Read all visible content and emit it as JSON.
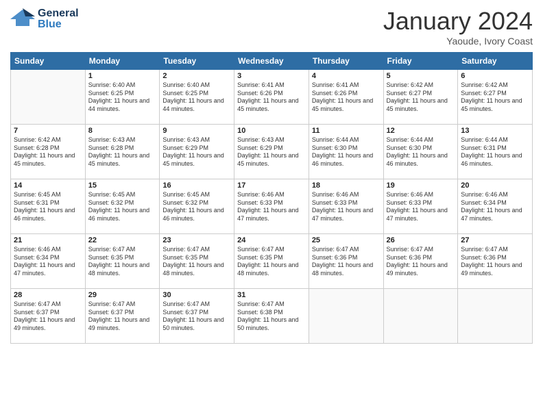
{
  "header": {
    "logo_general": "General",
    "logo_blue": "Blue",
    "month_title": "January 2024",
    "subtitle": "Yaoude, Ivory Coast"
  },
  "days_of_week": [
    "Sunday",
    "Monday",
    "Tuesday",
    "Wednesday",
    "Thursday",
    "Friday",
    "Saturday"
  ],
  "weeks": [
    [
      {
        "day": "",
        "sunrise": "",
        "sunset": "",
        "daylight": ""
      },
      {
        "day": "1",
        "sunrise": "Sunrise: 6:40 AM",
        "sunset": "Sunset: 6:25 PM",
        "daylight": "Daylight: 11 hours and 44 minutes."
      },
      {
        "day": "2",
        "sunrise": "Sunrise: 6:40 AM",
        "sunset": "Sunset: 6:25 PM",
        "daylight": "Daylight: 11 hours and 44 minutes."
      },
      {
        "day": "3",
        "sunrise": "Sunrise: 6:41 AM",
        "sunset": "Sunset: 6:26 PM",
        "daylight": "Daylight: 11 hours and 45 minutes."
      },
      {
        "day": "4",
        "sunrise": "Sunrise: 6:41 AM",
        "sunset": "Sunset: 6:26 PM",
        "daylight": "Daylight: 11 hours and 45 minutes."
      },
      {
        "day": "5",
        "sunrise": "Sunrise: 6:42 AM",
        "sunset": "Sunset: 6:27 PM",
        "daylight": "Daylight: 11 hours and 45 minutes."
      },
      {
        "day": "6",
        "sunrise": "Sunrise: 6:42 AM",
        "sunset": "Sunset: 6:27 PM",
        "daylight": "Daylight: 11 hours and 45 minutes."
      }
    ],
    [
      {
        "day": "7",
        "sunrise": "Sunrise: 6:42 AM",
        "sunset": "Sunset: 6:28 PM",
        "daylight": "Daylight: 11 hours and 45 minutes."
      },
      {
        "day": "8",
        "sunrise": "Sunrise: 6:43 AM",
        "sunset": "Sunset: 6:28 PM",
        "daylight": "Daylight: 11 hours and 45 minutes."
      },
      {
        "day": "9",
        "sunrise": "Sunrise: 6:43 AM",
        "sunset": "Sunset: 6:29 PM",
        "daylight": "Daylight: 11 hours and 45 minutes."
      },
      {
        "day": "10",
        "sunrise": "Sunrise: 6:43 AM",
        "sunset": "Sunset: 6:29 PM",
        "daylight": "Daylight: 11 hours and 45 minutes."
      },
      {
        "day": "11",
        "sunrise": "Sunrise: 6:44 AM",
        "sunset": "Sunset: 6:30 PM",
        "daylight": "Daylight: 11 hours and 46 minutes."
      },
      {
        "day": "12",
        "sunrise": "Sunrise: 6:44 AM",
        "sunset": "Sunset: 6:30 PM",
        "daylight": "Daylight: 11 hours and 46 minutes."
      },
      {
        "day": "13",
        "sunrise": "Sunrise: 6:44 AM",
        "sunset": "Sunset: 6:31 PM",
        "daylight": "Daylight: 11 hours and 46 minutes."
      }
    ],
    [
      {
        "day": "14",
        "sunrise": "Sunrise: 6:45 AM",
        "sunset": "Sunset: 6:31 PM",
        "daylight": "Daylight: 11 hours and 46 minutes."
      },
      {
        "day": "15",
        "sunrise": "Sunrise: 6:45 AM",
        "sunset": "Sunset: 6:32 PM",
        "daylight": "Daylight: 11 hours and 46 minutes."
      },
      {
        "day": "16",
        "sunrise": "Sunrise: 6:45 AM",
        "sunset": "Sunset: 6:32 PM",
        "daylight": "Daylight: 11 hours and 46 minutes."
      },
      {
        "day": "17",
        "sunrise": "Sunrise: 6:46 AM",
        "sunset": "Sunset: 6:33 PM",
        "daylight": "Daylight: 11 hours and 47 minutes."
      },
      {
        "day": "18",
        "sunrise": "Sunrise: 6:46 AM",
        "sunset": "Sunset: 6:33 PM",
        "daylight": "Daylight: 11 hours and 47 minutes."
      },
      {
        "day": "19",
        "sunrise": "Sunrise: 6:46 AM",
        "sunset": "Sunset: 6:33 PM",
        "daylight": "Daylight: 11 hours and 47 minutes."
      },
      {
        "day": "20",
        "sunrise": "Sunrise: 6:46 AM",
        "sunset": "Sunset: 6:34 PM",
        "daylight": "Daylight: 11 hours and 47 minutes."
      }
    ],
    [
      {
        "day": "21",
        "sunrise": "Sunrise: 6:46 AM",
        "sunset": "Sunset: 6:34 PM",
        "daylight": "Daylight: 11 hours and 47 minutes."
      },
      {
        "day": "22",
        "sunrise": "Sunrise: 6:47 AM",
        "sunset": "Sunset: 6:35 PM",
        "daylight": "Daylight: 11 hours and 48 minutes."
      },
      {
        "day": "23",
        "sunrise": "Sunrise: 6:47 AM",
        "sunset": "Sunset: 6:35 PM",
        "daylight": "Daylight: 11 hours and 48 minutes."
      },
      {
        "day": "24",
        "sunrise": "Sunrise: 6:47 AM",
        "sunset": "Sunset: 6:35 PM",
        "daylight": "Daylight: 11 hours and 48 minutes."
      },
      {
        "day": "25",
        "sunrise": "Sunrise: 6:47 AM",
        "sunset": "Sunset: 6:36 PM",
        "daylight": "Daylight: 11 hours and 48 minutes."
      },
      {
        "day": "26",
        "sunrise": "Sunrise: 6:47 AM",
        "sunset": "Sunset: 6:36 PM",
        "daylight": "Daylight: 11 hours and 49 minutes."
      },
      {
        "day": "27",
        "sunrise": "Sunrise: 6:47 AM",
        "sunset": "Sunset: 6:36 PM",
        "daylight": "Daylight: 11 hours and 49 minutes."
      }
    ],
    [
      {
        "day": "28",
        "sunrise": "Sunrise: 6:47 AM",
        "sunset": "Sunset: 6:37 PM",
        "daylight": "Daylight: 11 hours and 49 minutes."
      },
      {
        "day": "29",
        "sunrise": "Sunrise: 6:47 AM",
        "sunset": "Sunset: 6:37 PM",
        "daylight": "Daylight: 11 hours and 49 minutes."
      },
      {
        "day": "30",
        "sunrise": "Sunrise: 6:47 AM",
        "sunset": "Sunset: 6:37 PM",
        "daylight": "Daylight: 11 hours and 50 minutes."
      },
      {
        "day": "31",
        "sunrise": "Sunrise: 6:47 AM",
        "sunset": "Sunset: 6:38 PM",
        "daylight": "Daylight: 11 hours and 50 minutes."
      },
      {
        "day": "",
        "sunrise": "",
        "sunset": "",
        "daylight": ""
      },
      {
        "day": "",
        "sunrise": "",
        "sunset": "",
        "daylight": ""
      },
      {
        "day": "",
        "sunrise": "",
        "sunset": "",
        "daylight": ""
      }
    ]
  ]
}
